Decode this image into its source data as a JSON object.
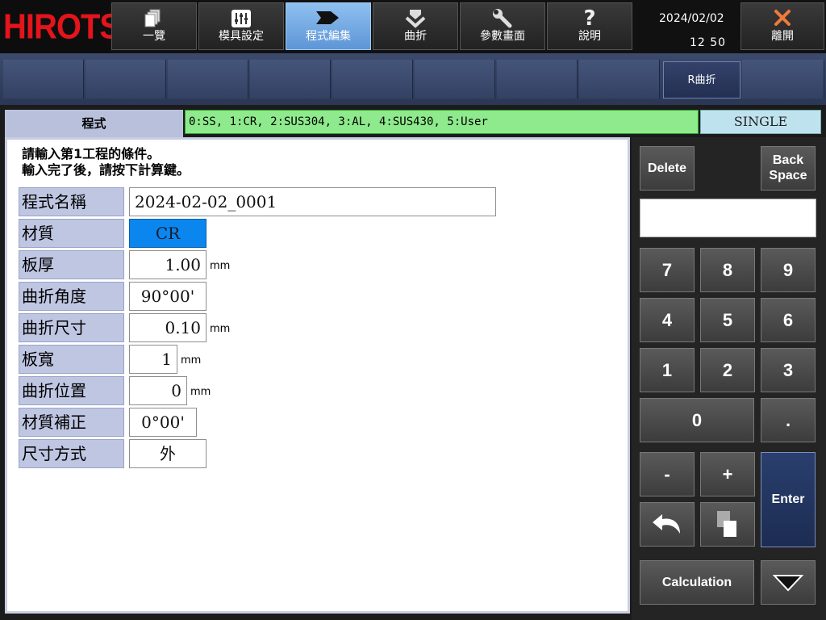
{
  "brand": {
    "logo_text": "HIROTSU",
    "logo_color": "#e3141b"
  },
  "nav": {
    "items": [
      {
        "label": "一覽",
        "icon": "list-icon"
      },
      {
        "label": "模具設定",
        "icon": "sliders-icon"
      },
      {
        "label": "程式編集",
        "icon": "arrow-tag-icon"
      },
      {
        "label": "曲折",
        "icon": "bend-down-icon"
      },
      {
        "label": "參數畫面",
        "icon": "wrench-icon"
      },
      {
        "label": "說明",
        "icon": "question-icon"
      }
    ],
    "active_index": 2,
    "date": "2024/02/02",
    "time": "12 50",
    "exit_label": "離開",
    "exit_icon": "close-icon"
  },
  "subbar": {
    "r_bend_label": "R曲折"
  },
  "program": {
    "tab_label": "程式",
    "material_hint": "0:SS, 1:CR, 2:SUS304, 3:AL, 4:SUS430, 5:User",
    "mode": "SINGLE",
    "instruction_line1": "請輸入第1工程的條件。",
    "instruction_line2": "輸入完了後，請按下計算鍵。",
    "fields": {
      "name": {
        "label": "程式名稱",
        "value": "2024-02-02_0001"
      },
      "material": {
        "label": "材質",
        "value": "CR"
      },
      "thickness": {
        "label": "板厚",
        "value": "1.00",
        "unit": "mm"
      },
      "angle": {
        "label": "曲折角度",
        "value": "90°00'"
      },
      "bend_size": {
        "label": "曲折尺寸",
        "value": "0.10",
        "unit": "mm"
      },
      "width": {
        "label": "板寬",
        "value": "1",
        "unit": "mm"
      },
      "position": {
        "label": "曲折位置",
        "value": "0",
        "unit": "mm"
      },
      "correction": {
        "label": "材質補正",
        "value": "0°00'"
      },
      "dim_mode": {
        "label": "尺寸方式",
        "value": "外"
      }
    }
  },
  "keypad": {
    "delete": "Delete",
    "backspace_line1": "Back",
    "backspace_line2": "Space",
    "entry_value": "",
    "digits": [
      "7",
      "8",
      "9",
      "4",
      "5",
      "6",
      "1",
      "2",
      "3"
    ],
    "zero": "0",
    "dot": ".",
    "minus": "-",
    "plus": "+",
    "enter": "Enter",
    "calculation": "Calculation",
    "undo_icon": "undo-icon",
    "copy_icon": "copy-icon",
    "down_icon": "triangle-down-icon"
  },
  "colors": {
    "active_tab": "#6fa8e6",
    "selected_field": "#0b86ee",
    "hint_bar": "#8eea8c",
    "mode_badge": "#bfe3ee"
  }
}
